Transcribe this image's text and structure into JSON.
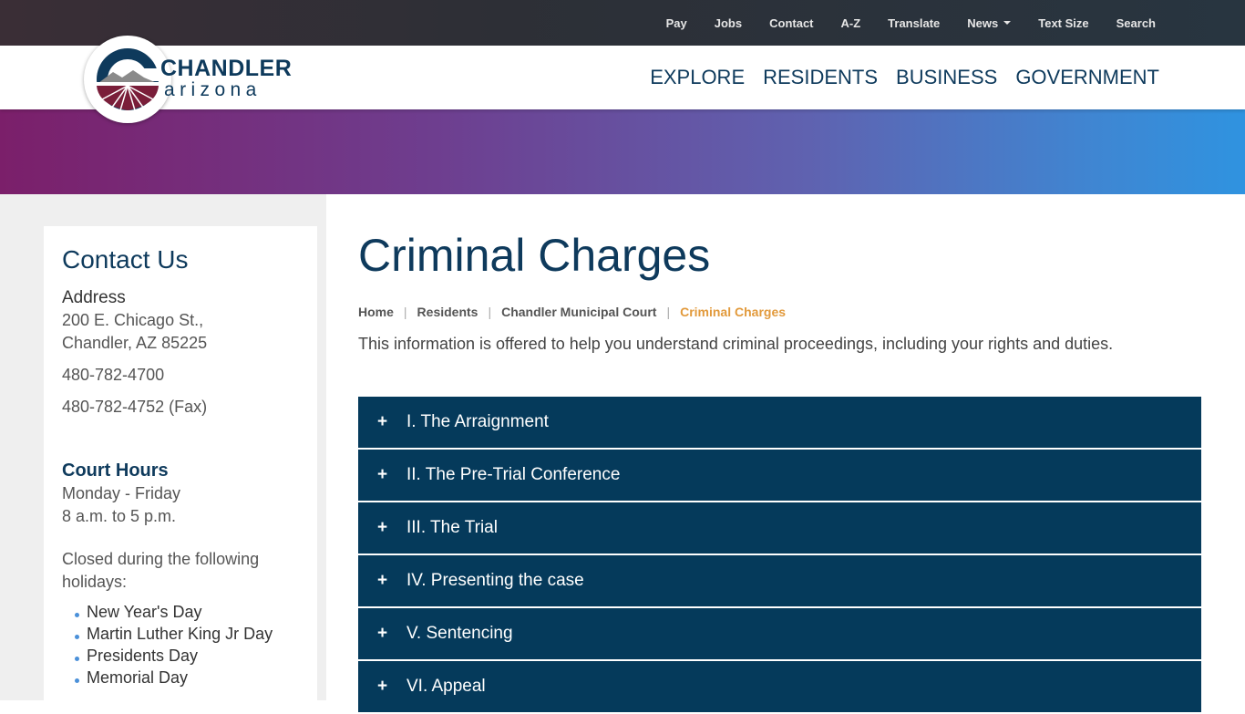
{
  "utility_nav": {
    "items": [
      "Pay",
      "Jobs",
      "Contact",
      "A-Z",
      "Translate",
      "News",
      "Text Size",
      "Search"
    ]
  },
  "brand": {
    "name": "CHANDLER",
    "subtitle": "arizona"
  },
  "main_nav": {
    "items": [
      "EXPLORE",
      "RESIDENTS",
      "BUSINESS",
      "GOVERNMENT"
    ]
  },
  "sidebar": {
    "title": "Contact Us",
    "address_label": "Address",
    "address_line1": "200 E. Chicago St.,",
    "address_line2": "Chandler, AZ 85225",
    "phone": "480-782-4700",
    "fax": "480-782-4752 (Fax)",
    "hours_title": "Court Hours",
    "hours_days": "Monday - Friday",
    "hours_time": "8 a.m. to 5 p.m.",
    "holidays_intro": "Closed during the following holidays:",
    "holidays": [
      "New Year's Day",
      "Martin Luther King Jr Day",
      "Presidents Day",
      "Memorial Day"
    ]
  },
  "content": {
    "title": "Criminal Charges",
    "breadcrumb": [
      "Home",
      "Residents",
      "Chandler Municipal Court",
      "Criminal Charges"
    ],
    "intro": "This information is offered to help you understand criminal proceedings, including your rights and duties.",
    "accordion": [
      "I. The Arraignment",
      "II. The Pre-Trial Conference",
      "III. The Trial",
      "IV. Presenting the case",
      "V. Sentencing",
      "VI. Appeal"
    ],
    "expand_symbol": "+"
  },
  "colors": {
    "navy": "#0e3a5c",
    "accordion_bg": "#053a5b",
    "breadcrumb_current": "#e29a3c",
    "logo_maroon": "#7a1e3a"
  }
}
